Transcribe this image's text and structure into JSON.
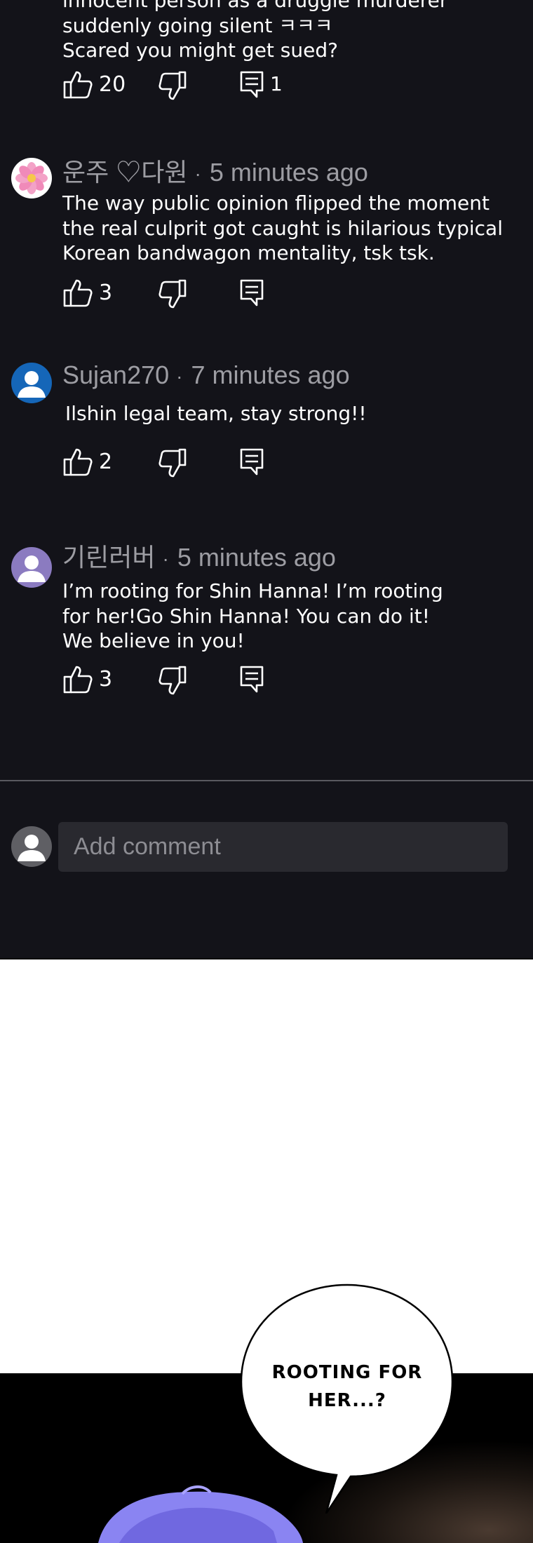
{
  "colors": {
    "background_dark": "#131319",
    "text_primary": "#ffffff",
    "text_secondary": "#9d9da3",
    "input_background": "#29292f",
    "divider": "#5a5a60"
  },
  "comments": [
    {
      "author": "",
      "time": "",
      "text_lines": [
        "innocent person as a druggie murderer",
        "suddenly going silent ㅋㅋㅋ",
        "Scared you might get sued?"
      ],
      "likes": "20",
      "replies": "1"
    },
    {
      "author": "운주 ♡다원",
      "time": "5 minutes ago",
      "avatar": "flower-icon",
      "text_lines": [
        "The way public opinion flipped the moment",
        "the real culprit got caught is hilarious typical",
        "Korean bandwagon mentality, tsk tsk."
      ],
      "likes": "3",
      "replies": ""
    },
    {
      "author": "Sujan270",
      "time": "7 minutes ago",
      "avatar": "user-icon",
      "avatar_color": "#1566b8",
      "text_lines": [
        "Ilshin legal team, stay strong!!"
      ],
      "likes": "2",
      "replies": ""
    },
    {
      "author": "기린러버",
      "time": "5 minutes ago",
      "avatar": "user-icon",
      "avatar_color": "#8b7bc0",
      "text_lines": [
        "I’m rooting for Shin Hanna! I’m rooting",
        "for her!Go Shin Hanna! You can do it!",
        "We believe in you!"
      ],
      "likes": "3",
      "replies": ""
    }
  ],
  "composer": {
    "placeholder": "Add comment",
    "avatar": "user-icon",
    "avatar_color": "#5f5f64"
  },
  "comic": {
    "speech_bubble_lines": [
      "ROOTING FOR",
      "HER...?"
    ]
  }
}
